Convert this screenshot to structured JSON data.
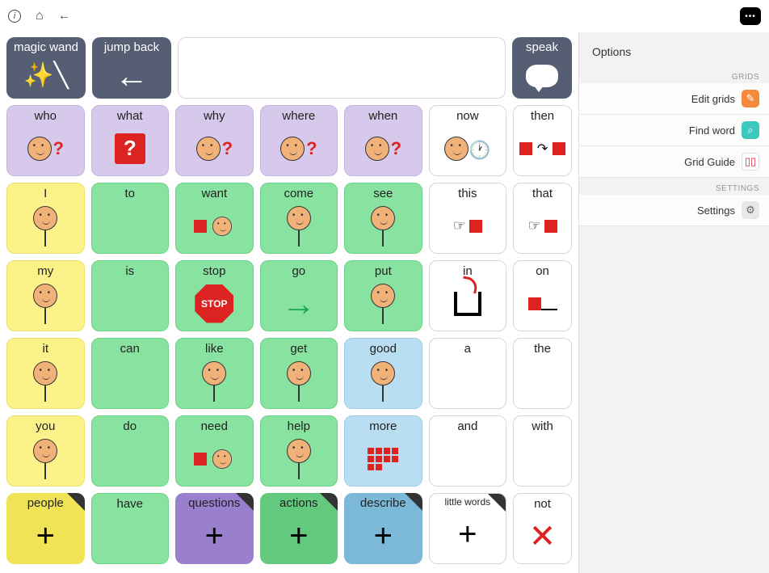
{
  "topbar": {
    "options_btn": "•••"
  },
  "sidebar": {
    "title": "Options",
    "sections": {
      "grids": "GRIDS",
      "settings": "SETTINGS"
    },
    "items": {
      "edit": "Edit grids",
      "find": "Find word",
      "guide": "Grid Guide",
      "settings": "Settings"
    }
  },
  "toprow": {
    "magic_wand": "magic wand",
    "jump_back": "jump back",
    "speak": "speak"
  },
  "grid": [
    [
      {
        "label": "who",
        "cls": "purple"
      },
      {
        "label": "what",
        "cls": "purple"
      },
      {
        "label": "why",
        "cls": "purple"
      },
      {
        "label": "where",
        "cls": "purple"
      },
      {
        "label": "when",
        "cls": "purple"
      },
      {
        "label": "now",
        "cls": "white"
      },
      {
        "label": "then",
        "cls": "white"
      }
    ],
    [
      {
        "label": "I",
        "cls": "yellow"
      },
      {
        "label": "to",
        "cls": "green"
      },
      {
        "label": "want",
        "cls": "green"
      },
      {
        "label": "come",
        "cls": "green"
      },
      {
        "label": "see",
        "cls": "green"
      },
      {
        "label": "this",
        "cls": "white"
      },
      {
        "label": "that",
        "cls": "white"
      }
    ],
    [
      {
        "label": "my",
        "cls": "yellow"
      },
      {
        "label": "is",
        "cls": "green"
      },
      {
        "label": "stop",
        "cls": "green"
      },
      {
        "label": "go",
        "cls": "green"
      },
      {
        "label": "put",
        "cls": "green"
      },
      {
        "label": "in",
        "cls": "white"
      },
      {
        "label": "on",
        "cls": "white"
      }
    ],
    [
      {
        "label": "it",
        "cls": "yellow"
      },
      {
        "label": "can",
        "cls": "green"
      },
      {
        "label": "like",
        "cls": "green"
      },
      {
        "label": "get",
        "cls": "green"
      },
      {
        "label": "good",
        "cls": "blue"
      },
      {
        "label": "a",
        "cls": "white"
      },
      {
        "label": "the",
        "cls": "white"
      }
    ],
    [
      {
        "label": "you",
        "cls": "yellow"
      },
      {
        "label": "do",
        "cls": "green"
      },
      {
        "label": "need",
        "cls": "green"
      },
      {
        "label": "help",
        "cls": "green"
      },
      {
        "label": "more",
        "cls": "blue"
      },
      {
        "label": "and",
        "cls": "white"
      },
      {
        "label": "with",
        "cls": "white"
      }
    ],
    [
      {
        "label": "people",
        "cls": "yellow-md",
        "corner": true,
        "plus": true
      },
      {
        "label": "have",
        "cls": "green"
      },
      {
        "label": "questions",
        "cls": "purple-dk",
        "corner": true,
        "plus": true
      },
      {
        "label": "actions",
        "cls": "green-md",
        "corner": true,
        "plus": true
      },
      {
        "label": "describe",
        "cls": "blue-md",
        "corner": true,
        "plus": true
      },
      {
        "label": "little words",
        "cls": "white",
        "corner": true,
        "plus": true,
        "tiny": true
      },
      {
        "label": "not",
        "cls": "white"
      }
    ]
  ]
}
